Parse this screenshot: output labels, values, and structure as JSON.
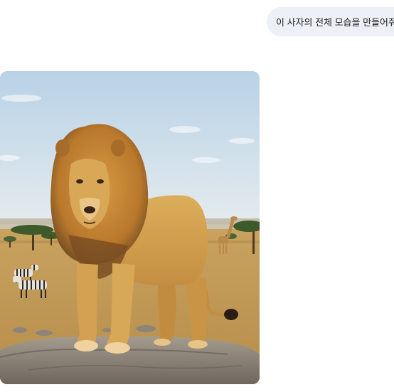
{
  "conversation": {
    "user_message": {
      "text": "이 사자의 전체 모습을 만들어줘"
    },
    "response_image": {
      "subject": "lion standing on a rock in savanna with zebras and giraffe",
      "colors": {
        "sky_top": "#b8d2e6",
        "sky_bottom": "#e4ebee",
        "grass": "#c9a25e",
        "lion_body": "#d7a24e",
        "mane": "#b9782c",
        "rock": "#8f867a"
      }
    }
  }
}
